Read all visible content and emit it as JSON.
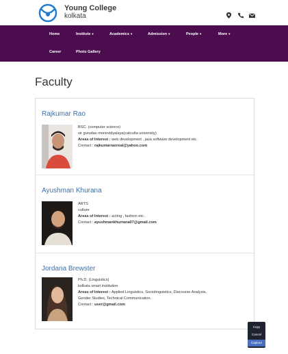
{
  "header": {
    "college_name": "Young College",
    "college_city": "kolkata",
    "icons": [
      "map-marker-icon",
      "phone-icon",
      "envelope-icon"
    ]
  },
  "nav": {
    "items": [
      {
        "label": "Home"
      },
      {
        "label": "Institute"
      },
      {
        "label": "Academics"
      },
      {
        "label": "Admission"
      },
      {
        "label": "People"
      },
      {
        "label": "More"
      },
      {
        "label": "Career"
      },
      {
        "label": "Photo Gallery"
      }
    ]
  },
  "page": {
    "title": "Faculty"
  },
  "faculty": [
    {
      "name": "Rajkumar Rao",
      "degree": "BSC. (computer science)",
      "institution": "sir gurudas monovidyalaya(calcutta university)",
      "interest_label": "Areas of Interest :",
      "interest": "web development , java software development etc.",
      "contact_label": "Contact :",
      "contact": "rajkumarraoreal@yahoo.com"
    },
    {
      "name": "Ayushman Khurana",
      "degree": "ARTS",
      "institution": "culture",
      "interest_label": "Areas of Interest :",
      "interest": "acting , fashion etc .",
      "contact_label": "Contact :",
      "contact": "ayushmankhurrana07@gmail.com"
    },
    {
      "name": "Jordana Brewster",
      "degree": "Ph.D. (Linguistics)",
      "institution": "kolkata smart institution",
      "interest_label": "Areas of Interest :",
      "interest": "Applied Linguistics, Sociolinguistics, Discourse Analysis,",
      "interest_cont": "Gender Studies, Technical Communication.",
      "contact_label": "Contact :",
      "contact": "user@gmail.com"
    }
  ],
  "context_menu": {
    "items": [
      "Copy",
      "Cancel",
      "Capture"
    ],
    "active": "Capture"
  }
}
